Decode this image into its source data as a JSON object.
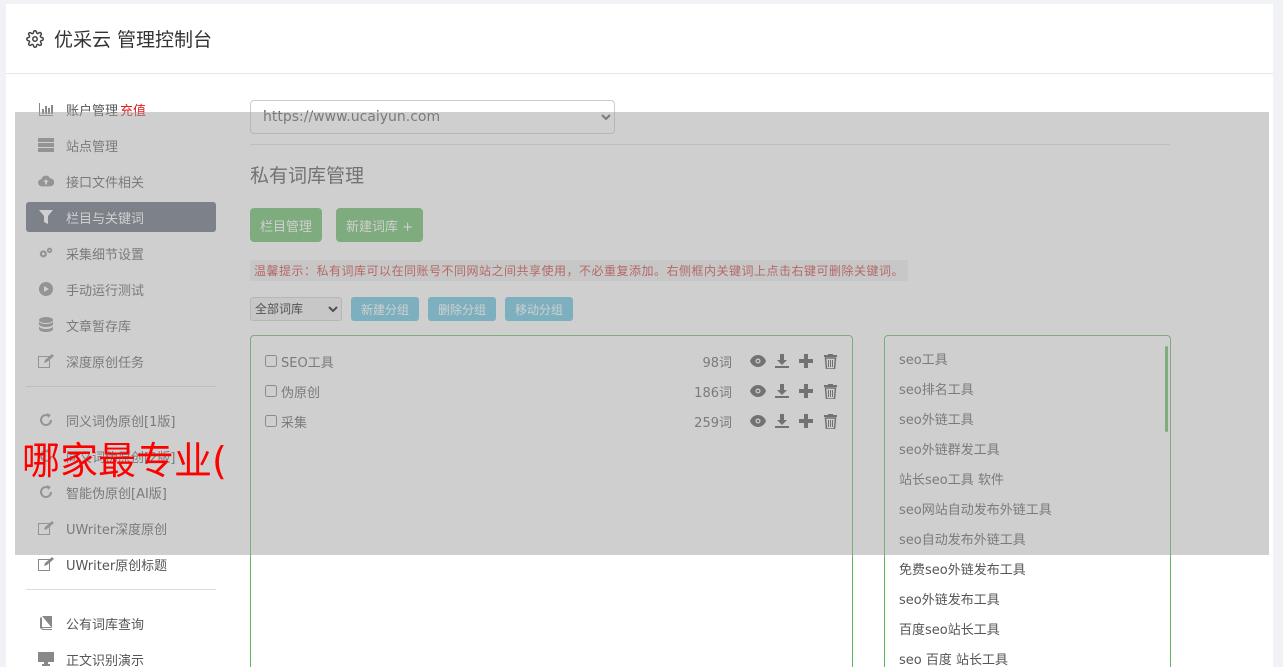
{
  "header": {
    "brand": "优采云 管理控制台"
  },
  "sidebar": {
    "group1": [
      {
        "label": "账户管理",
        "badge": "充值",
        "icon": "bar-chart-icon"
      },
      {
        "label": "站点管理",
        "icon": "server-icon"
      },
      {
        "label": "接口文件相关",
        "icon": "cloud-upload-icon"
      },
      {
        "label": "栏目与关键词",
        "icon": "filter-icon",
        "active": true
      },
      {
        "label": "采集细节设置",
        "icon": "gears-icon"
      },
      {
        "label": "手动运行测试",
        "icon": "play-circle-icon"
      },
      {
        "label": "文章暂存库",
        "icon": "database-icon"
      },
      {
        "label": "深度原创任务",
        "icon": "edit-icon"
      }
    ],
    "group2": [
      {
        "label": "同义词伪原创[1版]",
        "icon": "refresh-icon"
      },
      {
        "label": "同义词伪原创[2版]",
        "icon": "refresh-icon"
      },
      {
        "label": "智能伪原创[AI版]",
        "icon": "refresh-icon"
      },
      {
        "label": "UWriter深度原创",
        "icon": "edit-icon"
      },
      {
        "label": "UWriter原创标题",
        "icon": "edit-icon"
      }
    ],
    "group3": [
      {
        "label": "公有词库查询",
        "icon": "book-icon"
      },
      {
        "label": "正文识别演示",
        "icon": "desktop-icon"
      }
    ]
  },
  "main": {
    "site_select": "https://www.ucaiyun.com",
    "title": "私有词库管理",
    "btn_columns": "栏目管理",
    "btn_new_lib": "新建词库 +",
    "hint": "温馨提示：私有词库可以在同账号不同网站之间共享使用，不必重复添加。右侧框内关键词上点击右键可删除关键词。",
    "filter_select": "全部词库",
    "btn_new_group": "新建分组",
    "btn_del_group": "删除分组",
    "btn_move_group": "移动分组",
    "libraries": [
      {
        "name": "SEO工具",
        "count": "98词"
      },
      {
        "name": "伪原创",
        "count": "186词"
      },
      {
        "name": "采集",
        "count": "259词"
      }
    ],
    "keywords": [
      "seo工具",
      "seo排名工具",
      "seo外链工具",
      "seo外链群发工具",
      "站长seo工具 软件",
      "seo网站自动发布外链工具",
      "seo自动发布外链工具",
      "免费seo外链发布工具",
      "seo外链发布工具",
      "百度seo站长工具",
      "seo 百度 站长工具"
    ]
  },
  "overlay": {
    "text": "哪家最专业("
  },
  "colors": {
    "accent_green": "#5cb85c",
    "accent_blue": "#5bc0de",
    "active_nav": "#5b6372",
    "hint_red": "#c9302c"
  }
}
